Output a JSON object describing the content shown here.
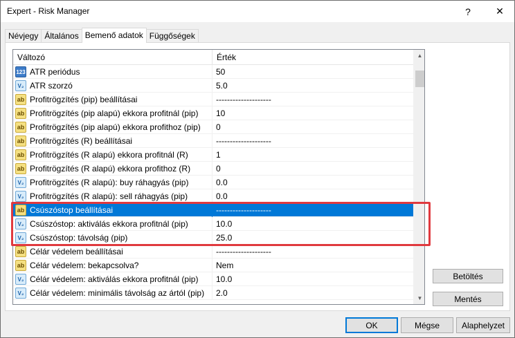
{
  "window": {
    "title": "Expert - Risk Manager",
    "help_glyph": "?",
    "close_glyph": "✕"
  },
  "tabs": [
    {
      "label": "Névjegy",
      "active": false
    },
    {
      "label": "Általános",
      "active": false
    },
    {
      "label": "Bemenő adatok",
      "active": true
    },
    {
      "label": "Függőségek",
      "active": false
    }
  ],
  "grid": {
    "headers": {
      "variable": "Változó",
      "value": "Érték"
    },
    "rows": [
      {
        "type": "int",
        "icon_text": "123",
        "label": "ATR periódus",
        "value": "50"
      },
      {
        "type": "double",
        "icon_text": "V₂",
        "label": "ATR szorzó",
        "value": "5.0"
      },
      {
        "type": "str",
        "icon_text": "ab",
        "label": "Profitrögzítés (pip) beállításai",
        "value": "--------------------"
      },
      {
        "type": "str",
        "icon_text": "ab",
        "label": "Profitrögzítés (pip alapú) ekkora profitnál (pip)",
        "value": "10"
      },
      {
        "type": "str",
        "icon_text": "ab",
        "label": "Profitrögzítés (pip alapú) ekkora profithoz (pip)",
        "value": "0"
      },
      {
        "type": "str",
        "icon_text": "ab",
        "label": "Profitrögzítés (R) beállításai",
        "value": "--------------------"
      },
      {
        "type": "str",
        "icon_text": "ab",
        "label": "Profitrögzítés (R alapú) ekkora profitnál (R)",
        "value": "1"
      },
      {
        "type": "str",
        "icon_text": "ab",
        "label": "Profitrögzítés (R alapú) ekkora profithoz (R)",
        "value": "0"
      },
      {
        "type": "double",
        "icon_text": "V₂",
        "label": "Profitrögzítés (R alapú): buy ráhagyás (pip)",
        "value": "0.0"
      },
      {
        "type": "double",
        "icon_text": "V₂",
        "label": "Profitrögzítés (R alapú): sell ráhagyás (pip)",
        "value": "0.0"
      },
      {
        "type": "str",
        "icon_text": "ab",
        "label": "Csúszóstop beállításai",
        "value": "--------------------",
        "selected": true
      },
      {
        "type": "double",
        "icon_text": "V₂",
        "label": "Csúszóstop: aktiválás ekkora profitnál (pip)",
        "value": "10.0"
      },
      {
        "type": "double",
        "icon_text": "V₂",
        "label": "Csúszóstop: távolság (pip)",
        "value": "25.0"
      },
      {
        "type": "str",
        "icon_text": "ab",
        "label": "Célár védelem beállításai",
        "value": "--------------------"
      },
      {
        "type": "str",
        "icon_text": "ab",
        "label": "Célár védelem: bekapcsolva?",
        "value": "Nem"
      },
      {
        "type": "double",
        "icon_text": "V₂",
        "label": "Célár védelem: aktiválás ekkora profitnál (pip)",
        "value": "10.0"
      },
      {
        "type": "double",
        "icon_text": "V₂",
        "label": "Célár védelem: minimális távolság az ártól (pip)",
        "value": "2.0"
      }
    ]
  },
  "side_buttons": {
    "load": "Betöltés",
    "save": "Mentés"
  },
  "bottom_buttons": {
    "ok": "OK",
    "cancel": "Mégse",
    "reset": "Alaphelyzet"
  },
  "colors": {
    "selection": "#0078d7",
    "highlight_box": "#e0393e"
  }
}
